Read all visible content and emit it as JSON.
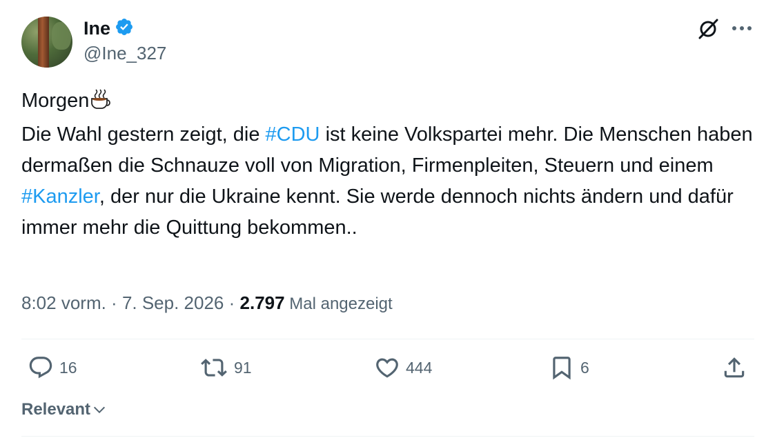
{
  "author": {
    "display_name": "Ine",
    "handle": "@Ine_327",
    "verified": true
  },
  "tweet": {
    "line1": "Morgen",
    "line1_emoji": "coffee-icon",
    "text_before_cdu": "Die Wahl gestern zeigt, die ",
    "hashtag_cdu": "#CDU",
    "text_after_cdu": " ist keine Volkspartei mehr. Die Menschen haben dermaßen die Schnauze voll von Migration, Firmenpleiten, Steuern und einem ",
    "hashtag_kanzler": "#Kanzler",
    "text_after_kanzler": ", der nur die Ukraine kennt. Sie werde dennoch nichts ändern und dafür immer mehr die Quittung bekommen.."
  },
  "meta": {
    "time": "8:02 vorm.",
    "sep1": " · ",
    "date": "7. Sep. 2026",
    "sep2": " · ",
    "views_count": "2.797",
    "views_label": " Mal angezeigt"
  },
  "actions": {
    "replies": "16",
    "retweets": "91",
    "likes": "444",
    "bookmarks": "6"
  },
  "sort": {
    "label": "Relevant"
  },
  "colors": {
    "accent": "#1d9bf0",
    "text_primary": "#0f1419",
    "text_secondary": "#536471",
    "divider": "#eff3f4"
  }
}
